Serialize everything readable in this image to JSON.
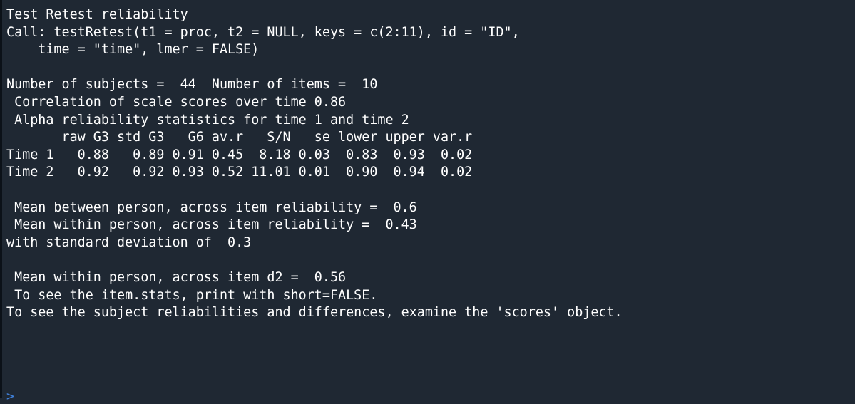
{
  "console": {
    "lines": [
      "Test Retest reliability",
      "Call: testRetest(t1 = proc, t2 = NULL, keys = c(2:11), id = \"ID\",",
      "    time = \"time\", lmer = FALSE)",
      "",
      "Number of subjects =  44  Number of items =  10",
      " Correlation of scale scores over time 0.86",
      " Alpha reliability statistics for time 1 and time 2",
      "       raw G3 std G3   G6 av.r   S/N   se lower upper var.r",
      "Time 1   0.88   0.89 0.91 0.45  8.18 0.03  0.83  0.93  0.02",
      "Time 2   0.92   0.92 0.93 0.52 11.01 0.01  0.90  0.94  0.02",
      "",
      " Mean between person, across item reliability =  0.6",
      " Mean within person, across item reliability =  0.43",
      "with standard deviation of  0.3",
      "",
      " Mean within person, across item d2 =  0.56",
      " To see the item.stats, print with short=FALSE.",
      "To see the subject reliabilities and differences, examine the 'scores' object."
    ],
    "prompt": ">"
  }
}
